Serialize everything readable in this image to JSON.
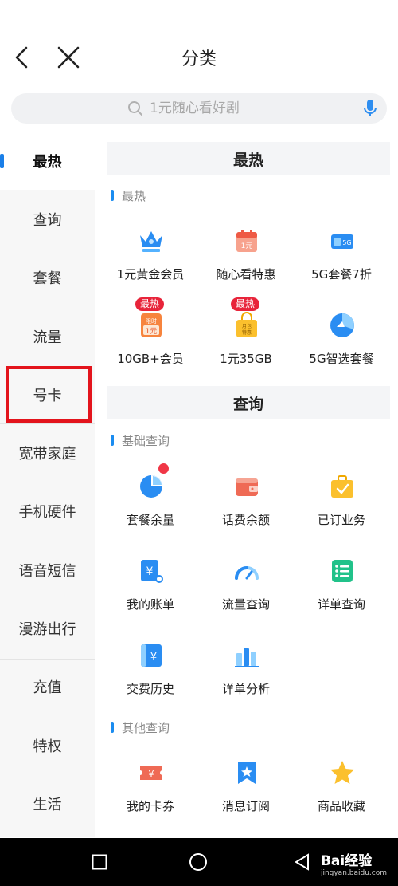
{
  "header": {
    "title": "分类"
  },
  "search": {
    "placeholder": "1元随心看好剧"
  },
  "sidebar": {
    "items": [
      {
        "label": "最热",
        "active": true
      },
      {
        "label": "查询"
      },
      {
        "label": "套餐"
      },
      {
        "label": "流量"
      },
      {
        "label": "号卡"
      },
      {
        "label": "宽带家庭"
      },
      {
        "label": "手机硬件"
      },
      {
        "label": "语音短信"
      },
      {
        "label": "漫游出行"
      },
      {
        "label": "充值"
      },
      {
        "label": "特权"
      },
      {
        "label": "生活"
      }
    ]
  },
  "sections": [
    {
      "title": "最热",
      "groups": [
        {
          "subtitle": "最热",
          "items": [
            {
              "label": "1元黄金会员",
              "icon": "crown-icon"
            },
            {
              "label": "随心看特惠",
              "icon": "calendar-icon",
              "icon_text": "1元"
            },
            {
              "label": "5G套餐7折",
              "icon": "sim-card-icon",
              "icon_text": "5G"
            },
            {
              "label": "10GB+会员",
              "icon": "tag-icon",
              "badge": "最热",
              "icon_text_1": "限时",
              "icon_text_2": "1元"
            },
            {
              "label": "1元35GB",
              "icon": "shopping-bag-icon",
              "badge": "最热",
              "icon_text_1": "月包",
              "icon_text_2": "特惠"
            },
            {
              "label": "5G智选套餐",
              "icon": "pie-circle-icon"
            }
          ]
        }
      ]
    },
    {
      "title": "查询",
      "groups": [
        {
          "subtitle": "基础查询",
          "items": [
            {
              "label": "套餐余量",
              "icon": "pie-chart-icon"
            },
            {
              "label": "话费余额",
              "icon": "wallet-icon"
            },
            {
              "label": "已订业务",
              "icon": "briefcase-check-icon"
            },
            {
              "label": "我的账单",
              "icon": "bill-icon",
              "icon_text": "¥"
            },
            {
              "label": "流量查询",
              "icon": "speedometer-icon"
            },
            {
              "label": "详单查询",
              "icon": "list-icon"
            },
            {
              "label": "交费历史",
              "icon": "payment-history-icon",
              "icon_text": "¥"
            },
            {
              "label": "详单分析",
              "icon": "bar-chart-icon"
            }
          ]
        },
        {
          "subtitle": "其他查询",
          "items": [
            {
              "label": "我的卡券",
              "icon": "coupon-icon",
              "icon_text": "¥"
            },
            {
              "label": "消息订阅",
              "icon": "bookmark-star-icon"
            },
            {
              "label": "商品收藏",
              "icon": "star-icon"
            }
          ]
        }
      ]
    }
  ],
  "watermark": {
    "text": "Bai经验",
    "sub": "jingyan.baidu.com"
  },
  "colors": {
    "accent": "#1a7fe8",
    "badge": "#e8243a",
    "highlight": "#e3141c"
  }
}
